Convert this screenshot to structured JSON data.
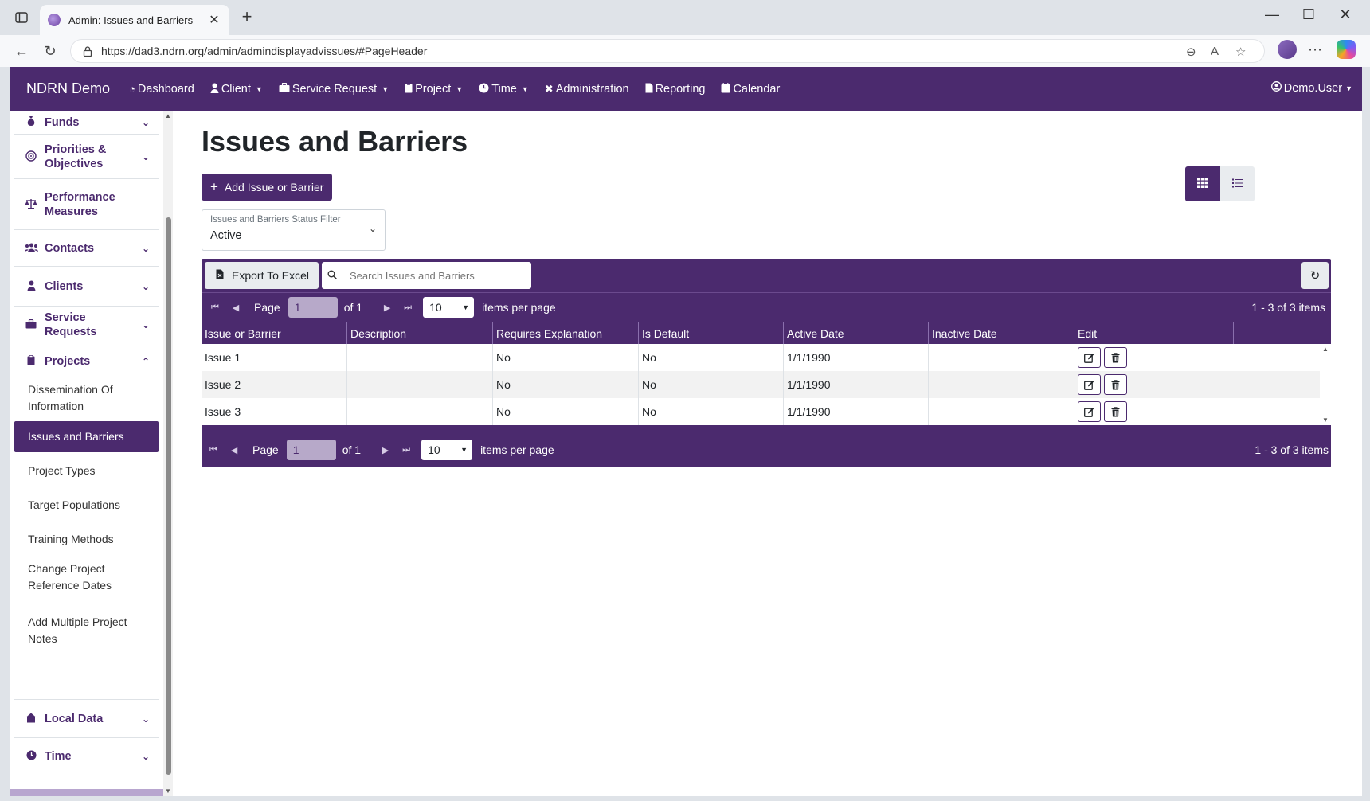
{
  "browser": {
    "tab_title": "Admin: Issues and Barriers",
    "url": "https://dad3.ndrn.org/admin/admindisplayadvissues/#PageHeader"
  },
  "topnav": {
    "brand": "NDRN Demo",
    "items": [
      {
        "label": "Dashboard",
        "icon": "gauge-icon",
        "dropdown": false
      },
      {
        "label": "Client",
        "icon": "person-icon",
        "dropdown": true
      },
      {
        "label": "Service Request",
        "icon": "briefcase-icon",
        "dropdown": true
      },
      {
        "label": "Project",
        "icon": "clipboard-icon",
        "dropdown": true
      },
      {
        "label": "Time",
        "icon": "clock-icon",
        "dropdown": true
      },
      {
        "label": "Administration",
        "icon": "tools-icon",
        "dropdown": false
      },
      {
        "label": "Reporting",
        "icon": "file-icon",
        "dropdown": false
      },
      {
        "label": "Calendar",
        "icon": "calendar-icon",
        "dropdown": false
      }
    ],
    "user": "Demo.User"
  },
  "sidebar": {
    "sections": [
      {
        "label": "Funds",
        "icon": "money-bag-icon",
        "expanded": false
      },
      {
        "label": "Priorities & Objectives",
        "icon": "target-icon",
        "expanded": false
      },
      {
        "label": "Performance Measures",
        "icon": "scale-icon",
        "expanded": false
      },
      {
        "label": "Contacts",
        "icon": "people-icon",
        "expanded": false
      },
      {
        "label": "Clients",
        "icon": "person-icon",
        "expanded": false
      },
      {
        "label": "Service Requests",
        "icon": "briefcase-icon",
        "expanded": false
      },
      {
        "label": "Projects",
        "icon": "clipboard-icon",
        "expanded": true
      },
      {
        "label": "Local Data",
        "icon": "house-icon",
        "expanded": false
      },
      {
        "label": "Time",
        "icon": "clock-icon",
        "expanded": false
      }
    ],
    "project_items": [
      "Dissemination Of Information",
      "Issues and Barriers",
      "Project Types",
      "Target Populations",
      "Training Methods",
      "Change Project Reference Dates",
      "Add Multiple Project Notes"
    ],
    "active_item": "Issues and Barriers"
  },
  "page": {
    "title": "Issues and Barriers",
    "add_button": "Add Issue or Barrier",
    "filter_label": "Issues and Barriers Status Filter",
    "filter_value": "Active"
  },
  "grid": {
    "export_label": "Export To Excel",
    "search_placeholder": "Search Issues and Barriers",
    "pager": {
      "page_label": "Page",
      "page_value": "1",
      "of_label": "of 1",
      "page_size": "10",
      "items_per_page_label": "items per page",
      "info": "1 - 3 of 3 items"
    },
    "columns": [
      "Issue or Barrier",
      "Description",
      "Requires Explanation",
      "Is Default",
      "Active Date",
      "Inactive Date",
      "Edit"
    ],
    "rows": [
      {
        "issue": "Issue 1",
        "description": "",
        "requires_explanation": "No",
        "is_default": "No",
        "active_date": "1/1/1990",
        "inactive_date": ""
      },
      {
        "issue": "Issue 2",
        "description": "",
        "requires_explanation": "No",
        "is_default": "No",
        "active_date": "1/1/1990",
        "inactive_date": ""
      },
      {
        "issue": "Issue 3",
        "description": "",
        "requires_explanation": "No",
        "is_default": "No",
        "active_date": "1/1/1990",
        "inactive_date": ""
      }
    ]
  },
  "colors": {
    "brand_purple": "#4b2a6e"
  }
}
